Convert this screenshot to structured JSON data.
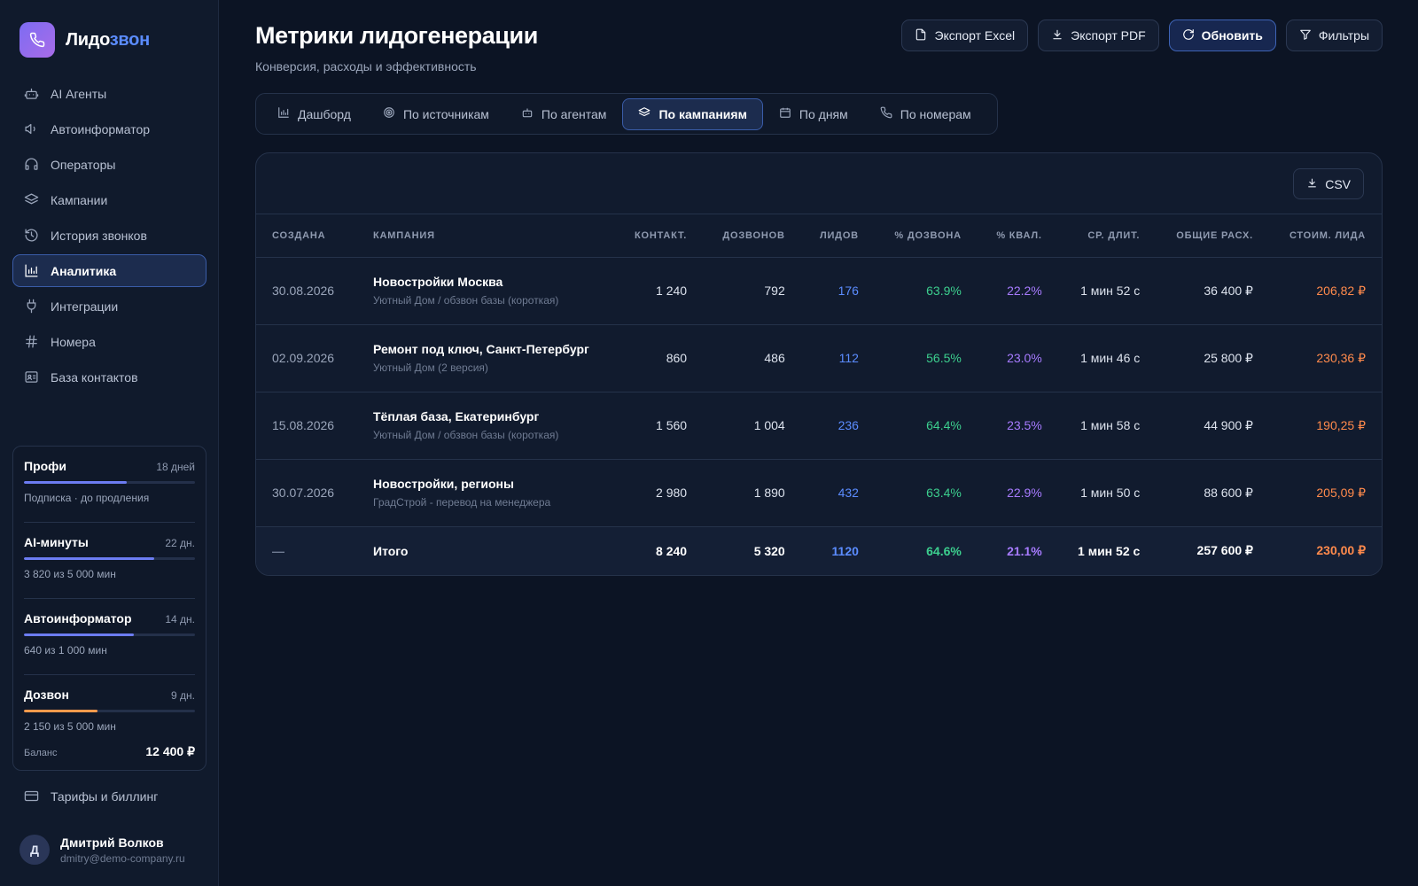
{
  "brand": {
    "name_prefix": "Лидо",
    "name_accent": "звон",
    "accent_color": "#5b8cff",
    "logo_icon": "phone-icon"
  },
  "sidebar": {
    "items": [
      {
        "label": "AI Агенты",
        "icon": "robot-icon",
        "active": false
      },
      {
        "label": "Автоинформатор",
        "icon": "speaker-icon",
        "active": false
      },
      {
        "label": "Операторы",
        "icon": "headset-icon",
        "active": false
      },
      {
        "label": "Кампании",
        "icon": "layers-icon",
        "active": false
      },
      {
        "label": "История звонков",
        "icon": "history-icon",
        "active": false
      },
      {
        "label": "Аналитика",
        "icon": "chart-icon",
        "active": true
      },
      {
        "label": "Интеграции",
        "icon": "plug-icon",
        "active": false
      },
      {
        "label": "Номера",
        "icon": "hash-icon",
        "active": false
      },
      {
        "label": "База контактов",
        "icon": "contact-card-icon",
        "active": false
      }
    ],
    "billing_label": "Тарифы и биллинг"
  },
  "plans": [
    {
      "name": "Профи",
      "days": "18 дней",
      "sub": "Подписка · до продления",
      "progress": 0.6,
      "color": "#6c7cf2"
    },
    {
      "name": "AI-минуты",
      "days": "22 дн.",
      "sub": "3 820 из 5 000 мин",
      "progress": 0.764,
      "color": "#6c7cf2"
    },
    {
      "name": "Автоинформатор",
      "days": "14 дн.",
      "sub": "640 из 1 000 мин",
      "progress": 0.64,
      "color": "#6c7cf2"
    },
    {
      "name": "Дозвон",
      "days": "9 дн.",
      "sub": "2 150 из 5 000 мин",
      "progress": 0.43,
      "color": "#ff9a4c"
    }
  ],
  "balance": {
    "label": "Баланс",
    "value": "12 400 ₽"
  },
  "user": {
    "initial": "Д",
    "name": "Дмитрий Волков",
    "email": "dmitry@demo-company.ru"
  },
  "page": {
    "title": "Метрики лидогенерации",
    "subtitle": "Конверсия, расходы и эффективность"
  },
  "actions": {
    "excel": "Экспорт Excel",
    "pdf": "Экспорт PDF",
    "refresh": "Обновить",
    "filters": "Фильтры"
  },
  "tabs": [
    {
      "label": "Дашборд",
      "icon": "bar-chart-icon",
      "active": false
    },
    {
      "label": "По источникам",
      "icon": "target-icon",
      "active": false
    },
    {
      "label": "По агентам",
      "icon": "robot-icon",
      "active": false
    },
    {
      "label": "По кампаниям",
      "icon": "layers-icon",
      "active": true
    },
    {
      "label": "По дням",
      "icon": "calendar-icon",
      "active": false
    },
    {
      "label": "По номерам",
      "icon": "phone-icon",
      "active": false
    }
  ],
  "table": {
    "csv_label": "CSV",
    "columns": [
      "СОЗДАНА",
      "КАМПАНИЯ",
      "КОНТАКТ.",
      "ДОЗВОНОВ",
      "ЛИДОВ",
      "% ДОЗВОНА",
      "% КВАЛ.",
      "СР. ДЛИТ.",
      "ОБЩИЕ РАСХ.",
      "СТОИМ. ЛИДА"
    ],
    "rows": [
      {
        "date": "30.08.2026",
        "name": "Новостройки Москва",
        "sub": "Уютный Дом / обзвон базы (короткая)",
        "contacts": "1 240",
        "connects": "792",
        "leads": "176",
        "connect_rate": "63.9%",
        "qual_rate": "22.2%",
        "avg_dur": "1 мин 52 с",
        "spend": "36 400 ₽",
        "cpl": "206,82 ₽"
      },
      {
        "date": "02.09.2026",
        "name": "Ремонт под ключ, Санкт-Петербург",
        "sub": "Уютный Дом (2 версия)",
        "contacts": "860",
        "connects": "486",
        "leads": "112",
        "connect_rate": "56.5%",
        "qual_rate": "23.0%",
        "avg_dur": "1 мин 46 с",
        "spend": "25 800 ₽",
        "cpl": "230,36 ₽"
      },
      {
        "date": "15.08.2026",
        "name": "Тёплая база, Екатеринбург",
        "sub": "Уютный Дом / обзвон базы (короткая)",
        "contacts": "1 560",
        "connects": "1 004",
        "leads": "236",
        "connect_rate": "64.4%",
        "qual_rate": "23.5%",
        "avg_dur": "1 мин 58 с",
        "spend": "44 900 ₽",
        "cpl": "190,25 ₽"
      },
      {
        "date": "30.07.2026",
        "name": "Новостройки, регионы",
        "sub": "ГрадСтрой - перевод на менеджера",
        "contacts": "2 980",
        "connects": "1 890",
        "leads": "432",
        "connect_rate": "63.4%",
        "qual_rate": "22.9%",
        "avg_dur": "1 мин 50 с",
        "spend": "88 600 ₽",
        "cpl": "205,09 ₽"
      }
    ],
    "total": {
      "date": "—",
      "name": "Итого",
      "contacts": "8 240",
      "connects": "5 320",
      "leads": "1120",
      "connect_rate": "64.6%",
      "qual_rate": "21.1%",
      "avg_dur": "1 мин 52 с",
      "spend": "257 600 ₽",
      "cpl": "230,00 ₽"
    }
  }
}
